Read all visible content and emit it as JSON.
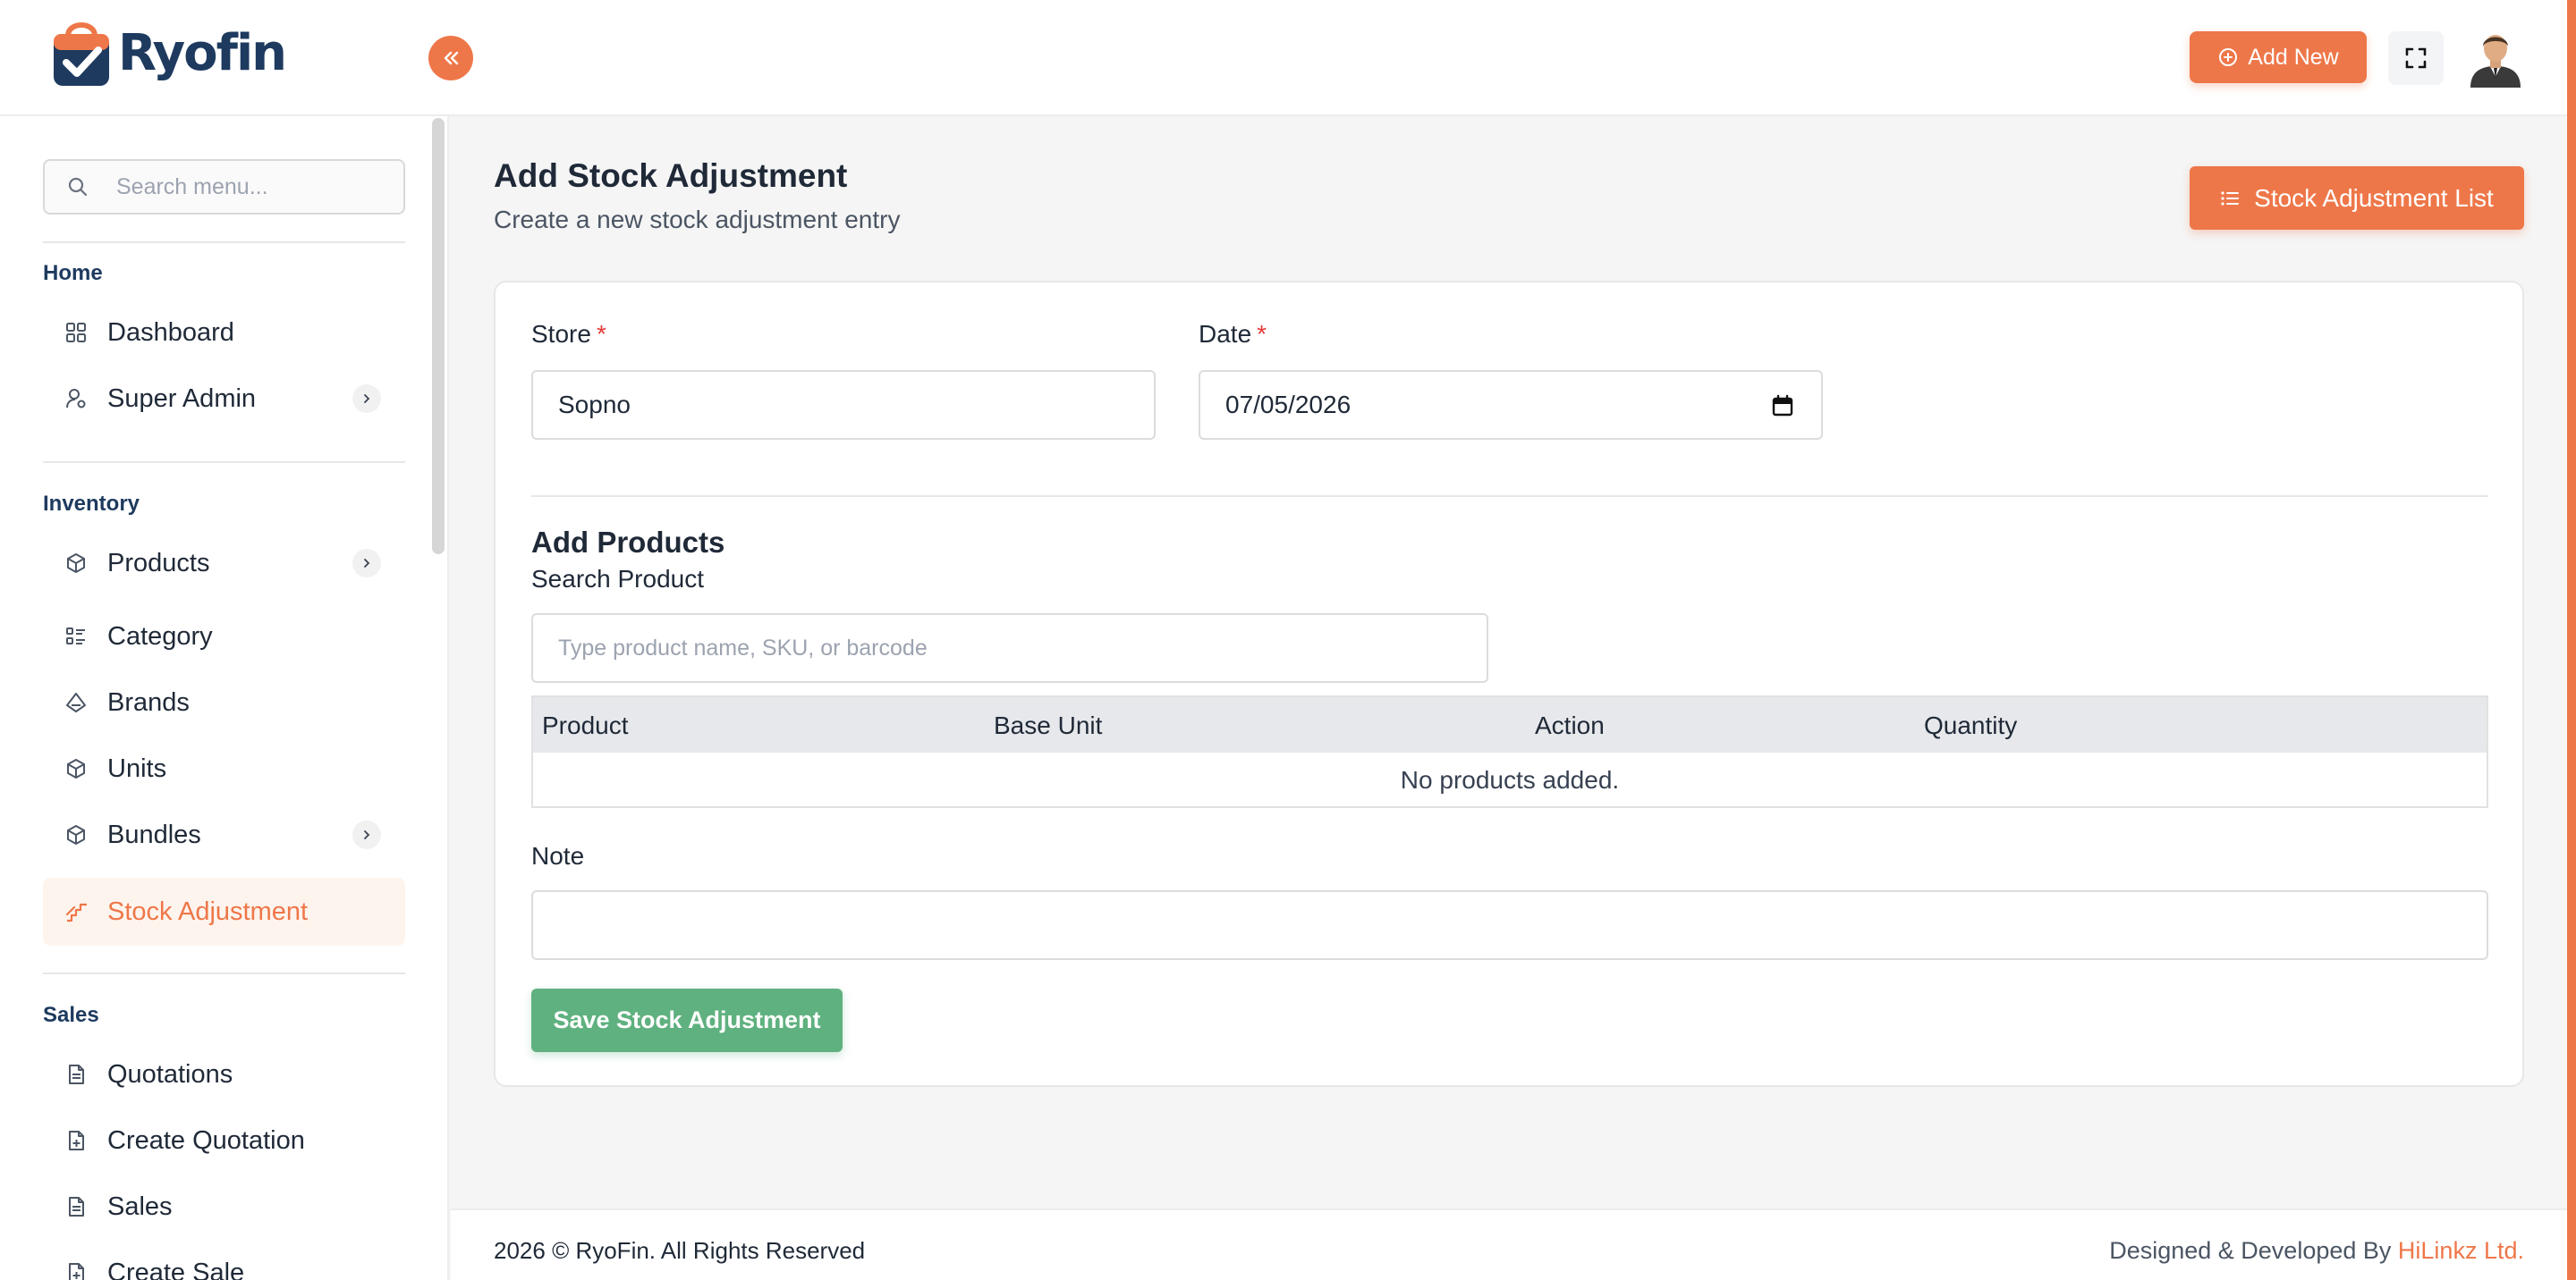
{
  "app": {
    "brand_name": "Ryofin"
  },
  "header": {
    "add_new_label": "Add New"
  },
  "sidebar": {
    "search_placeholder": "Search menu...",
    "sections": {
      "home": "Home",
      "inventory": "Inventory",
      "sales": "Sales"
    },
    "items": [
      {
        "label": "Dashboard",
        "icon": "grid-icon",
        "has_submenu": false
      },
      {
        "label": "Super Admin",
        "icon": "user-gear-icon",
        "has_submenu": true
      },
      {
        "label": "Products",
        "icon": "box-icon",
        "has_submenu": true
      },
      {
        "label": "Category",
        "icon": "list-icon",
        "has_submenu": false
      },
      {
        "label": "Brands",
        "icon": "brand-icon",
        "has_submenu": false
      },
      {
        "label": "Units",
        "icon": "cube-icon",
        "has_submenu": false
      },
      {
        "label": "Bundles",
        "icon": "box-icon",
        "has_submenu": true
      },
      {
        "label": "Stock Adjustment",
        "icon": "stairs-icon",
        "has_submenu": false,
        "active": true
      },
      {
        "label": "Quotations",
        "icon": "document-icon",
        "has_submenu": false
      },
      {
        "label": "Create Quotation",
        "icon": "document-plus-icon",
        "has_submenu": false
      },
      {
        "label": "Sales",
        "icon": "document-icon",
        "has_submenu": false
      },
      {
        "label": "Create Sale",
        "icon": "document-plus-icon",
        "has_submenu": false
      }
    ]
  },
  "main": {
    "title": "Add Stock Adjustment",
    "subtitle": "Create a new stock adjustment entry",
    "list_button_label": "Stock Adjustment List",
    "form": {
      "store_label": "Store",
      "store_value": "Sopno",
      "date_label": "Date",
      "date_value": "07/05/2026",
      "required_mark": "*",
      "add_products_title": "Add Products",
      "search_product_label": "Search Product",
      "search_product_placeholder": "Type product name, SKU, or barcode",
      "table": {
        "columns": [
          "Product",
          "Base Unit",
          "Action",
          "Quantity"
        ],
        "empty_text": "No products added."
      },
      "note_label": "Note",
      "note_value": "",
      "save_button_label": "Save Stock Adjustment"
    }
  },
  "footer": {
    "copyright": "2026 © RyoFin. All Rights Reserved",
    "designed_by": "Designed & Developed By",
    "developer": "HiLinkz Ltd."
  },
  "colors": {
    "accent": "#ee7749",
    "brand_navy": "#1e3a5f",
    "success": "#5fb17f"
  }
}
